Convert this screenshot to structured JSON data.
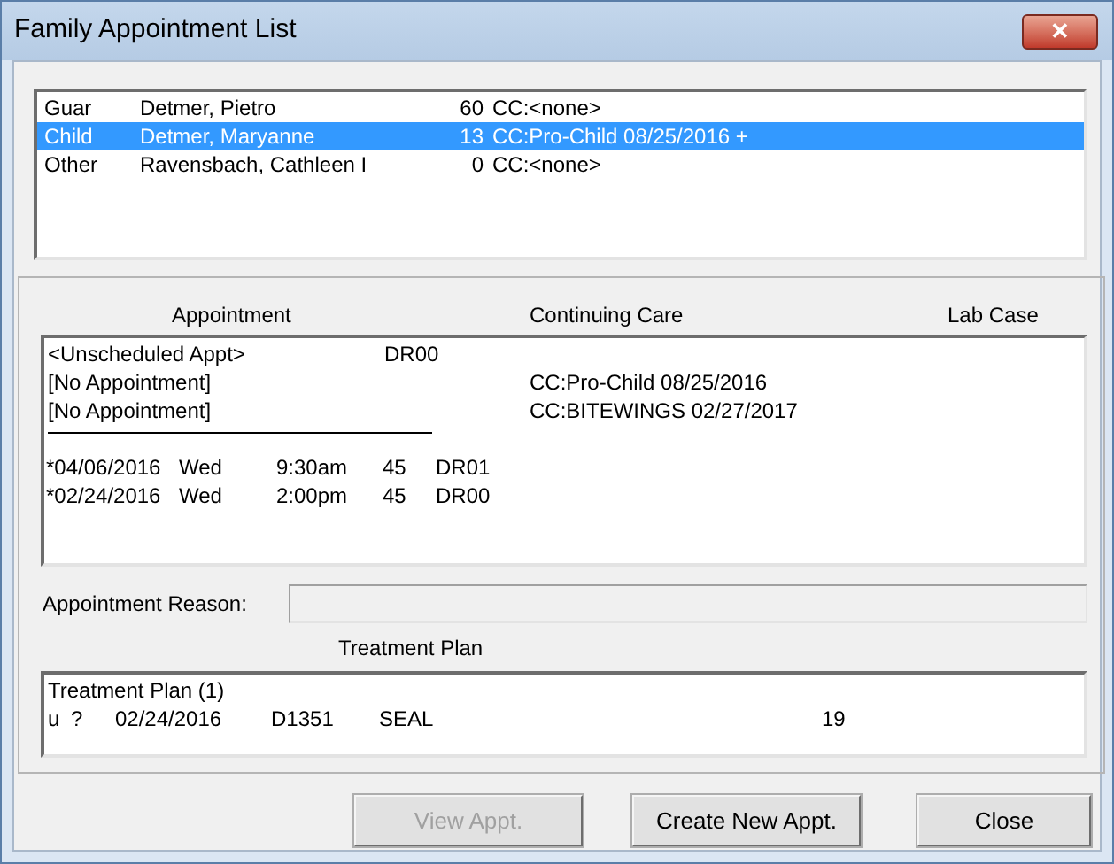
{
  "window": {
    "title": "Family Appointment List",
    "close": "✕"
  },
  "family": [
    {
      "relation": "Guar",
      "name": "Detmer, Pietro",
      "count": "60",
      "cc": "CC:<none>",
      "selected": false
    },
    {
      "relation": "Child",
      "name": "Detmer, Maryanne",
      "count": "13",
      "cc": "CC:Pro-Child 08/25/2016 +",
      "selected": true
    },
    {
      "relation": "Other",
      "name": "Ravensbach, Cathleen I",
      "count": "0",
      "cc": "CC:<none>",
      "selected": false
    }
  ],
  "appointment_headers": [
    "Appointment",
    "Continuing Care",
    "Lab Case"
  ],
  "appointments": [
    {
      "kind": "unscheduled",
      "text": "<Unscheduled Appt>",
      "provider": "DR00"
    },
    {
      "kind": "none",
      "text": "[No Appointment]",
      "care": "CC:Pro-Child 08/25/2016"
    },
    {
      "kind": "none",
      "text": "[No Appointment]",
      "care": "CC:BITEWINGS 02/27/2017"
    },
    {
      "kind": "separator"
    },
    {
      "kind": "scheduled",
      "date": "*04/06/2016",
      "day": "Wed",
      "time": "9:30am",
      "length": "45",
      "provider": "DR01"
    },
    {
      "kind": "scheduled",
      "date": "*02/24/2016",
      "day": "Wed",
      "time": "2:00pm",
      "length": "45",
      "provider": "DR00"
    }
  ],
  "appointment_reason": {
    "label": "Appointment Reason:"
  },
  "treatment_plan": {
    "header": "Treatment Plan",
    "title": "Treatment Plan (1)",
    "rows": [
      {
        "status": "u",
        "mark": "?",
        "date": "02/24/2016",
        "code": "D1351",
        "description": "SEAL",
        "tooth": "19"
      }
    ]
  },
  "buttons": [
    {
      "label": "View Appt.",
      "disabled": true
    },
    {
      "label": "Create New Appt.",
      "disabled": false
    },
    {
      "label": "Close",
      "disabled": false
    }
  ]
}
